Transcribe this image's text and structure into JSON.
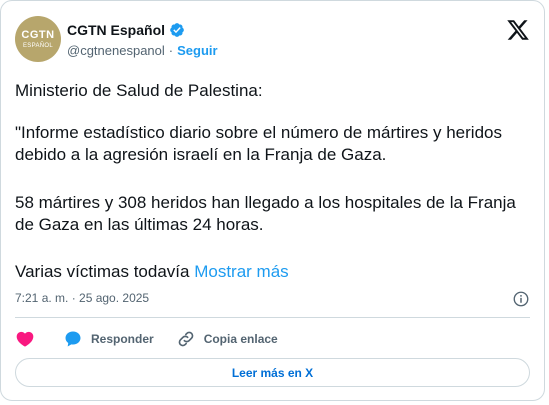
{
  "account": {
    "avatar_text_main": "CGTN",
    "avatar_text_sub": "ESPAÑOL",
    "display_name": "CGTN Español",
    "handle": "@cgtnenespanol",
    "separator": "·",
    "follow_label": "Seguir",
    "verified_icon": "verified-badge-icon",
    "brand_color": "#1d9bf0"
  },
  "tweet": {
    "paragraphs": [
      "Ministerio de Salud de Palestina:",
      "\"Informe estadístico diario sobre el número de mártires y heridos debido a la agresión israelí en la Franja de Gaza.",
      "58 mártires y 308 heridos han llegado a los hospitales de la Franja de Gaza en las últimas 24 horas."
    ],
    "truncated_text": "Varias víctimas todavía",
    "show_more_label": "Mostrar más",
    "timestamp": "7:21 a. m. · 25 ago. 2025"
  },
  "actions": {
    "like_icon": "heart-icon",
    "reply_label": "Responder",
    "reply_icon": "speech-bubble-icon",
    "copy_label": "Copia enlace",
    "copy_icon": "link-icon",
    "like_color": "#f91880"
  },
  "read_more_label": "Leer más en X"
}
